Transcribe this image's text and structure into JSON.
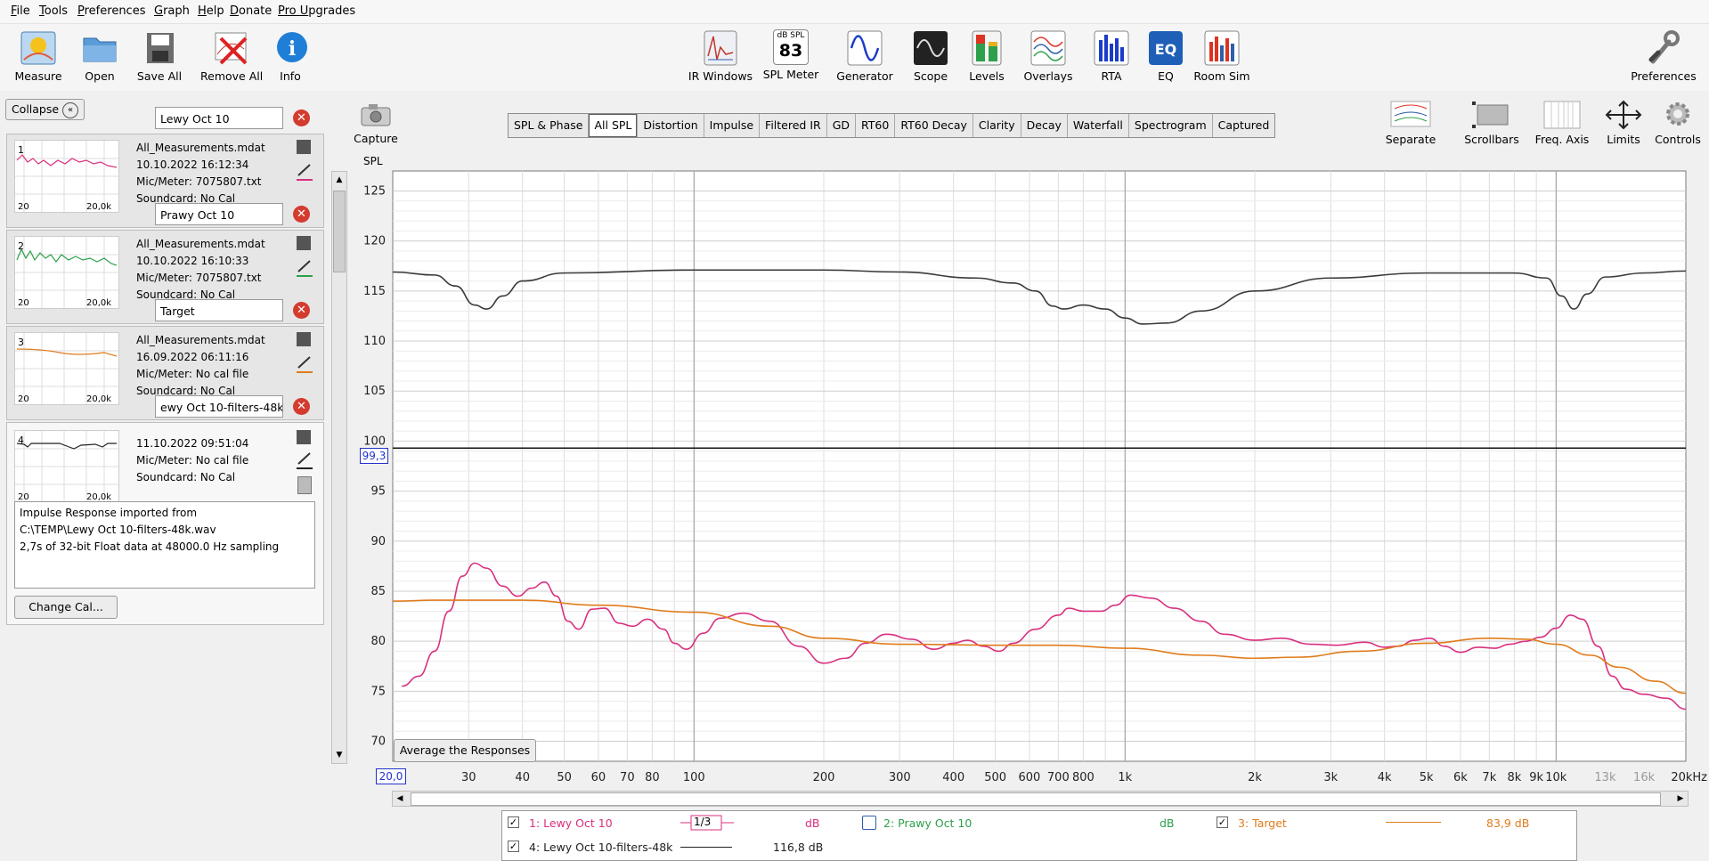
{
  "menu": [
    {
      "label": "File",
      "u": "F",
      "rest": "ile"
    },
    {
      "label": "Tools",
      "u": "T",
      "rest": "ools"
    },
    {
      "label": "Preferences",
      "u": "P",
      "rest": "references"
    },
    {
      "label": "Graph",
      "u": "G",
      "rest": "raph"
    },
    {
      "label": "Help",
      "u": "H",
      "rest": "elp"
    },
    {
      "label": "Donate",
      "u": "D",
      "rest": "onate"
    },
    {
      "label": "Pro Upgrades",
      "u": "Pro U",
      "rest": "pgrades"
    }
  ],
  "toolbar": {
    "left": [
      "Measure",
      "Open",
      "Save All",
      "Remove All",
      "Info"
    ],
    "center": [
      "IR Windows",
      "SPL Meter",
      "Generator",
      "Scope",
      "Levels",
      "Overlays",
      "RTA",
      "EQ",
      "Room Sim"
    ],
    "spl_meter_top": "dB SPL",
    "spl_meter_value": "83",
    "right": "Preferences"
  },
  "sidebar": {
    "collapse_label": "Collapse",
    "capture_label": "Capture",
    "measurements": [
      {
        "index": "1",
        "name": "Lewy Oct 10",
        "file": "All_Measurements.mdat",
        "date": "10.10.2022 16:12:34",
        "mic": "Mic/Meter: 7075807.txt",
        "sound": "Soundcard: No Cal",
        "color": "#d9307f",
        "x0": "20",
        "x1": "20,0k"
      },
      {
        "index": "2",
        "name": "Prawy Oct 10",
        "file": "All_Measurements.mdat",
        "date": "10.10.2022 16:10:33",
        "mic": "Mic/Meter: 7075807.txt",
        "sound": "Soundcard: No Cal",
        "color": "#2ea04b",
        "x0": "20",
        "x1": "20,0k"
      },
      {
        "index": "3",
        "name": "Target",
        "file": "All_Measurements.mdat",
        "date": "16.09.2022 06:11:16",
        "mic": "Mic/Meter: No cal file",
        "sound": "Soundcard: No Cal",
        "color": "#e07c1c",
        "x0": "20",
        "x1": "20,0k"
      },
      {
        "index": "4",
        "name": "ewy Oct 10-filters-48k",
        "file": "",
        "date": "11.10.2022 09:51:04",
        "mic": "Mic/Meter: No cal file",
        "sound": "Soundcard: No Cal",
        "color": "#222222",
        "x0": "20",
        "x1": "20,0k"
      }
    ],
    "notes": [
      "Impulse Response imported from",
      "C:\\TEMP\\Lewy Oct 10-filters-48k.wav",
      "2,7s of 32-bit Float data at 48000.0 Hz sampling"
    ],
    "change_cal_label": "Change Cal..."
  },
  "graph": {
    "tabs": [
      "SPL & Phase",
      "All SPL",
      "Distortion",
      "Impulse",
      "Filtered IR",
      "GD",
      "RT60",
      "RT60 Decay",
      "Clarity",
      "Decay",
      "Waterfall",
      "Spectrogram",
      "Captured"
    ],
    "active_tab": "All SPL",
    "right_tools": [
      "Separate",
      "Scrollbars",
      "Freq. Axis",
      "Limits",
      "Controls"
    ],
    "ylabel": "SPL",
    "cursor_value": "99,3",
    "x_start_value": "20,0",
    "average_button": "Average the Responses"
  },
  "chart_data": {
    "type": "line",
    "xscale": "log",
    "xlim": [
      20,
      20000
    ],
    "ylim": [
      68,
      127
    ],
    "y_ticks": [
      70,
      75,
      80,
      85,
      90,
      95,
      100,
      105,
      110,
      115,
      120,
      125
    ],
    "x_ticks": [
      {
        "v": 30,
        "t": "30"
      },
      {
        "v": 40,
        "t": "40"
      },
      {
        "v": 50,
        "t": "50"
      },
      {
        "v": 60,
        "t": "60"
      },
      {
        "v": 70,
        "t": "70"
      },
      {
        "v": 80,
        "t": "80"
      },
      {
        "v": 100,
        "t": "100"
      },
      {
        "v": 200,
        "t": "200"
      },
      {
        "v": 300,
        "t": "300"
      },
      {
        "v": 400,
        "t": "400"
      },
      {
        "v": 500,
        "t": "500"
      },
      {
        "v": 600,
        "t": "600"
      },
      {
        "v": 700,
        "t": "700"
      },
      {
        "v": 800,
        "t": "800"
      },
      {
        "v": 1000,
        "t": "1k"
      },
      {
        "v": 2000,
        "t": "2k"
      },
      {
        "v": 3000,
        "t": "3k"
      },
      {
        "v": 4000,
        "t": "4k"
      },
      {
        "v": 5000,
        "t": "5k"
      },
      {
        "v": 6000,
        "t": "6k"
      },
      {
        "v": 7000,
        "t": "7k"
      },
      {
        "v": 8000,
        "t": "8k"
      },
      {
        "v": 9000,
        "t": "9k"
      },
      {
        "v": 10000,
        "t": "10k"
      },
      {
        "v": 13000,
        "t": "13k"
      },
      {
        "v": 16000,
        "t": "16k"
      },
      {
        "v": 20000,
        "t": "20kHz"
      }
    ],
    "cursor_y": 99.3,
    "grid": true,
    "series": [
      {
        "name": "4: Lewy Oct 10-filters-48k",
        "color": "#3a3a3a",
        "points": [
          [
            20,
            116.9
          ],
          [
            25,
            116.6
          ],
          [
            28,
            115.5
          ],
          [
            31,
            113.6
          ],
          [
            33,
            113.2
          ],
          [
            36,
            114.5
          ],
          [
            40,
            116
          ],
          [
            50,
            116.8
          ],
          [
            100,
            117.1
          ],
          [
            200,
            117.1
          ],
          [
            300,
            116.9
          ],
          [
            450,
            116.3
          ],
          [
            550,
            115.8
          ],
          [
            620,
            115
          ],
          [
            680,
            113.5
          ],
          [
            720,
            113.2
          ],
          [
            800,
            113.6
          ],
          [
            900,
            113.2
          ],
          [
            1000,
            112.3
          ],
          [
            1100,
            111.7
          ],
          [
            1250,
            111.8
          ],
          [
            1500,
            113
          ],
          [
            2000,
            115
          ],
          [
            3000,
            116.3
          ],
          [
            5000,
            116.8
          ],
          [
            8000,
            116.8
          ],
          [
            9500,
            116.3
          ],
          [
            10300,
            114.5
          ],
          [
            11000,
            113.2
          ],
          [
            11800,
            114.7
          ],
          [
            13000,
            116.4
          ],
          [
            16000,
            116.8
          ],
          [
            20000,
            117.0
          ]
        ]
      },
      {
        "name": "1: Lewy Oct 10",
        "color": "#d9307f",
        "points": [
          [
            21,
            75.5
          ],
          [
            23,
            76.5
          ],
          [
            25,
            79
          ],
          [
            27,
            83
          ],
          [
            29,
            86.5
          ],
          [
            31,
            87.8
          ],
          [
            33,
            87.3
          ],
          [
            36,
            85.5
          ],
          [
            39,
            84.5
          ],
          [
            42,
            85.3
          ],
          [
            45,
            85.9
          ],
          [
            48,
            84.5
          ],
          [
            51,
            82
          ],
          [
            54,
            81.2
          ],
          [
            58,
            83.2
          ],
          [
            62,
            83.3
          ],
          [
            67,
            81.8
          ],
          [
            72,
            81.5
          ],
          [
            78,
            82.2
          ],
          [
            85,
            81.2
          ],
          [
            90,
            79.8
          ],
          [
            96,
            79.2
          ],
          [
            105,
            80.8
          ],
          [
            115,
            82.3
          ],
          [
            130,
            82.8
          ],
          [
            150,
            82
          ],
          [
            175,
            79.5
          ],
          [
            200,
            77.8
          ],
          [
            225,
            78.3
          ],
          [
            250,
            79.8
          ],
          [
            280,
            80.7
          ],
          [
            320,
            80.2
          ],
          [
            360,
            79.2
          ],
          [
            400,
            79.8
          ],
          [
            430,
            80.1
          ],
          [
            470,
            79.5
          ],
          [
            510,
            79
          ],
          [
            550,
            79.8
          ],
          [
            620,
            81.2
          ],
          [
            700,
            82.6
          ],
          [
            740,
            83.3
          ],
          [
            800,
            83
          ],
          [
            880,
            83
          ],
          [
            950,
            83.6
          ],
          [
            1030,
            84.6
          ],
          [
            1150,
            84.3
          ],
          [
            1300,
            83.3
          ],
          [
            1500,
            82
          ],
          [
            1700,
            80.7
          ],
          [
            2000,
            80.1
          ],
          [
            2300,
            80.3
          ],
          [
            2700,
            79.7
          ],
          [
            3100,
            79.6
          ],
          [
            3600,
            79.9
          ],
          [
            4000,
            79.4
          ],
          [
            4300,
            79.5
          ],
          [
            4700,
            80.1
          ],
          [
            5100,
            80.3
          ],
          [
            5500,
            79.5
          ],
          [
            6000,
            78.9
          ],
          [
            6600,
            79.4
          ],
          [
            7200,
            79.3
          ],
          [
            7800,
            79.7
          ],
          [
            8500,
            80
          ],
          [
            9200,
            80.4
          ],
          [
            10000,
            81.3
          ],
          [
            10800,
            82.6
          ],
          [
            11500,
            82.2
          ],
          [
            12500,
            79.5
          ],
          [
            13500,
            76.5
          ],
          [
            14500,
            75.2
          ],
          [
            16000,
            74.7
          ],
          [
            18000,
            74.3
          ],
          [
            20000,
            73.2
          ]
        ]
      },
      {
        "name": "3: Target",
        "color": "#e07c1c",
        "points": [
          [
            20,
            84
          ],
          [
            25,
            84.1
          ],
          [
            30,
            84.1
          ],
          [
            40,
            84.1
          ],
          [
            60,
            83.6
          ],
          [
            100,
            82.9
          ],
          [
            150,
            81.5
          ],
          [
            200,
            80.3
          ],
          [
            300,
            79.7
          ],
          [
            500,
            79.6
          ],
          [
            700,
            79.6
          ],
          [
            1000,
            79.3
          ],
          [
            1500,
            78.6
          ],
          [
            2000,
            78.3
          ],
          [
            2500,
            78.4
          ],
          [
            3500,
            79
          ],
          [
            5000,
            79.8
          ],
          [
            7000,
            80.3
          ],
          [
            8500,
            80.2
          ],
          [
            10000,
            79.7
          ],
          [
            12000,
            78.6
          ],
          [
            14000,
            77.4
          ],
          [
            17000,
            76
          ],
          [
            20000,
            74.8
          ]
        ]
      }
    ]
  },
  "legend": {
    "items": [
      {
        "checked": true,
        "label": "1: Lewy Oct 10",
        "color": "#d9307f",
        "smoothing": "1/3",
        "value": "dB"
      },
      {
        "checked": false,
        "label": "2: Prawy Oct 10",
        "color": "#2ea04b",
        "value": "dB"
      },
      {
        "checked": true,
        "label": "3: Target",
        "color": "#e07c1c",
        "value": "83,9 dB"
      },
      {
        "checked": true,
        "label": "4: Lewy Oct 10-filters-48k",
        "color": "#222222",
        "value": "116,8 dB"
      }
    ]
  }
}
